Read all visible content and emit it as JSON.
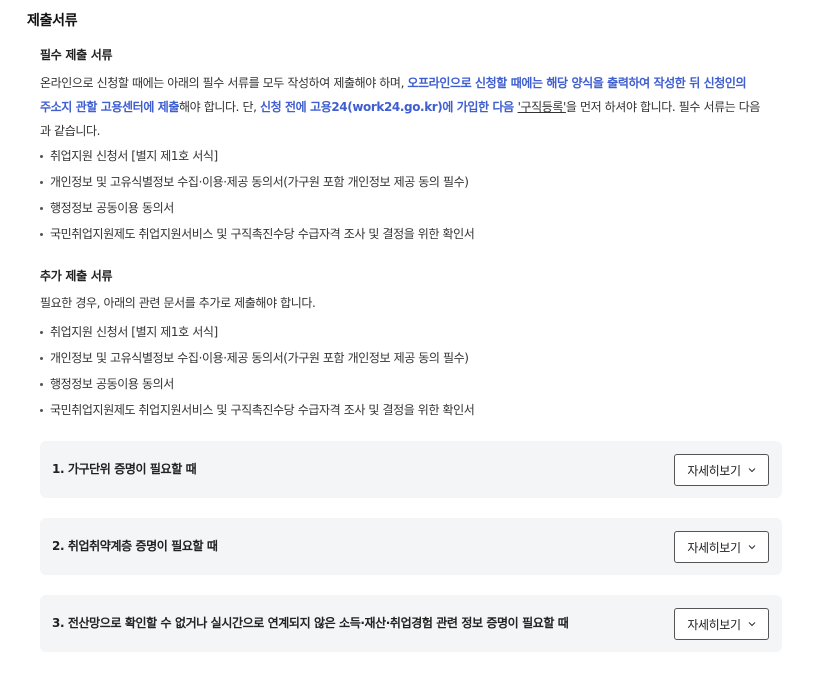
{
  "section_title": "제출서류",
  "required": {
    "title": "필수 제출 서류",
    "intro": {
      "part1": "온라인으로 신청할 때에는 아래의 필수 서류를 모두 작성하여 제출해야 하며, ",
      "bold1_line1": "오프라인으로 신청할 때에는 해당 양식을 출력하여 작성한 뒤 신청인의",
      "bold1_line2": "주소지 관할 고용센터에 제출",
      "part2": "해야 합니다. 단, ",
      "bold2": "신청 전에 고용24(work24.go.kr)에 가입한 다음 ",
      "link": "'구직등록'",
      "part3": "을 먼저 하셔야 합니다. 필수 서류는 다음",
      "part4": "과 같습니다."
    },
    "items": [
      "취업지원 신청서 [별지 제1호 서식]",
      "개인정보 및 고유식별정보 수집·이용·제공 동의서(가구원 포함 개인정보 제공 동의 필수)",
      "행정정보 공동이용 동의서",
      "국민취업지원제도 취업지원서비스 및 구직촉진수당 수급자격 조사 및 결정을 위한 확인서"
    ]
  },
  "additional": {
    "title": "추가 제출 서류",
    "intro": "필요한 경우, 아래의 관련 문서를 추가로 제출해야 합니다.",
    "items": [
      "취업지원 신청서 [별지 제1호 서식]",
      "개인정보 및 고유식별정보 수집·이용·제공 동의서(가구원 포함 개인정보 제공 동의 필수)",
      "행정정보 공동이용 동의서",
      "국민취업지원제도 취업지원서비스 및 구직촉진수당 수급자격 조사 및 결정을 위한 확인서"
    ]
  },
  "accordions": [
    {
      "title": "1. 가구단위 증명이 필요할 때",
      "button": "자세히보기"
    },
    {
      "title": "2. 취업취약계층 증명이 필요할 때",
      "button": "자세히보기"
    },
    {
      "title": "3. 전산망으로 확인할 수 없거나 실시간으로 연계되지 않은 소득·재산·취업경험 관련 정보 증명이 필요할 때",
      "button": "자세히보기"
    }
  ],
  "colors": {
    "accent_blue": "#3f5ed0",
    "accordion_bg": "#f4f5f7"
  },
  "icons": {
    "detail_button": "chevron-down-icon"
  }
}
